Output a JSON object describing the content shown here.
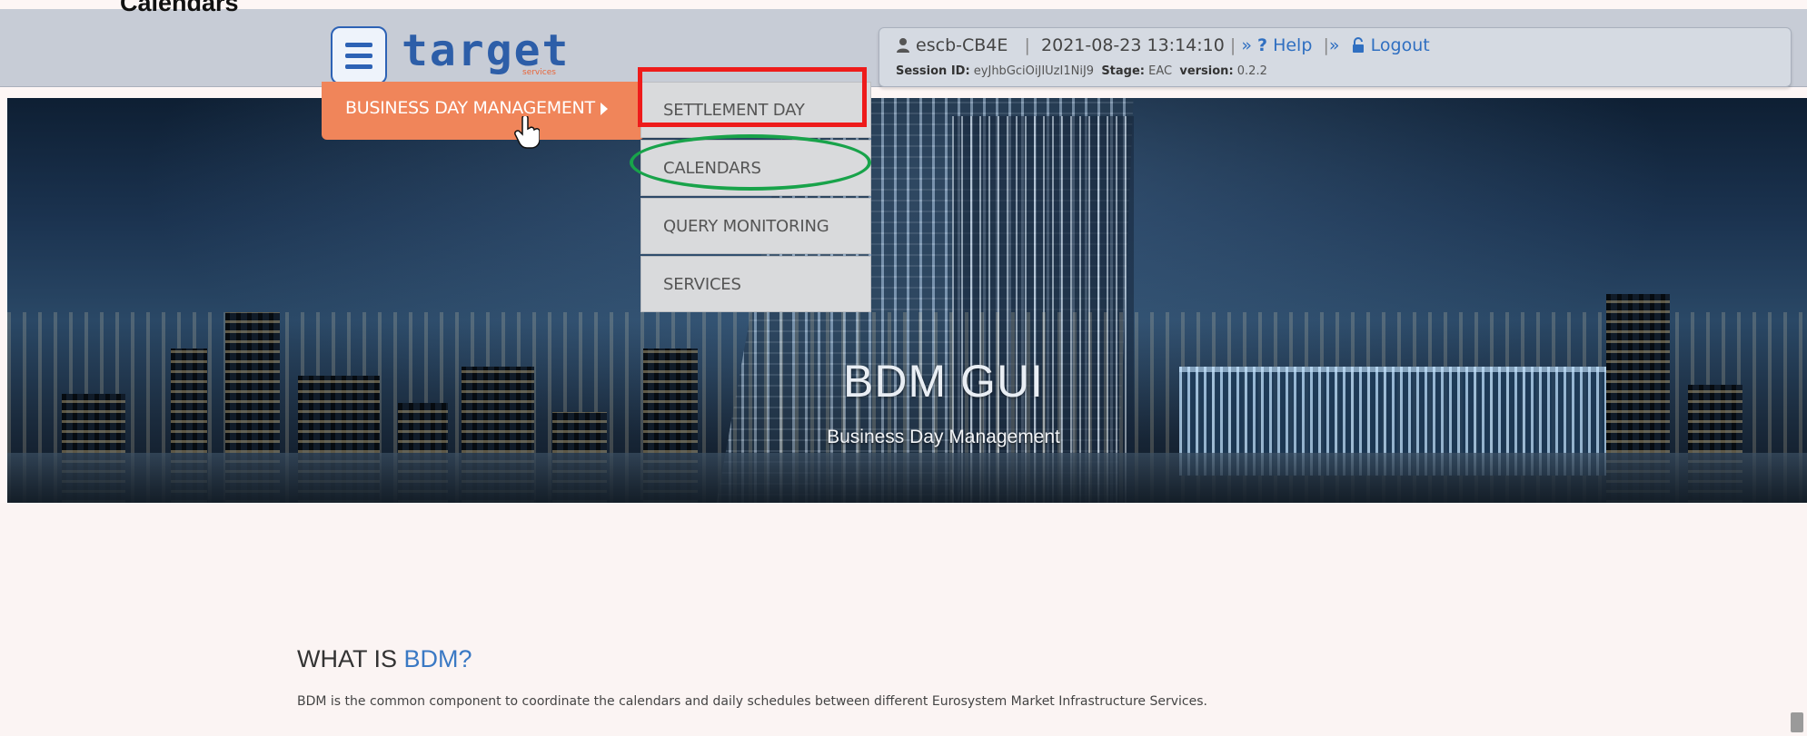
{
  "doc_caption": "Calendars",
  "header": {
    "logo_text": "target",
    "logo_sub": "services",
    "session": {
      "user": "escb-CB4E",
      "datetime": "2021-08-23 13:14:10",
      "help_label": "Help",
      "logout_label": "Logout",
      "session_id_label": "Session ID:",
      "session_id_value": "eyJhbGciOiJIUzI1NiJ9",
      "stage_label": "Stage:",
      "stage_value": "EAC",
      "version_label": "version:",
      "version_value": "0.2.2"
    }
  },
  "menu": {
    "main_item": "BUSINESS DAY MANAGEMENT",
    "submenu": [
      "SETTLEMENT DAY",
      "CALENDARS",
      "QUERY MONITORING",
      "SERVICES"
    ]
  },
  "hero": {
    "title": "BDM GUI",
    "subtitle": "Business Day Management"
  },
  "content": {
    "heading_prefix": "WHAT IS ",
    "heading_accent": "BDM?",
    "description": "BDM is the common component to coordinate the calendars and daily schedules between different Eurosystem Market Infrastructure Services."
  },
  "colors": {
    "brand_blue": "#2d62b5",
    "menu_orange": "#f0855a",
    "highlight_red": "#ee1b1b",
    "highlight_green": "#18a34a"
  },
  "icons": [
    "menu-icon",
    "user-icon",
    "help-icon",
    "lock-icon",
    "cursor-hand-icon"
  ]
}
